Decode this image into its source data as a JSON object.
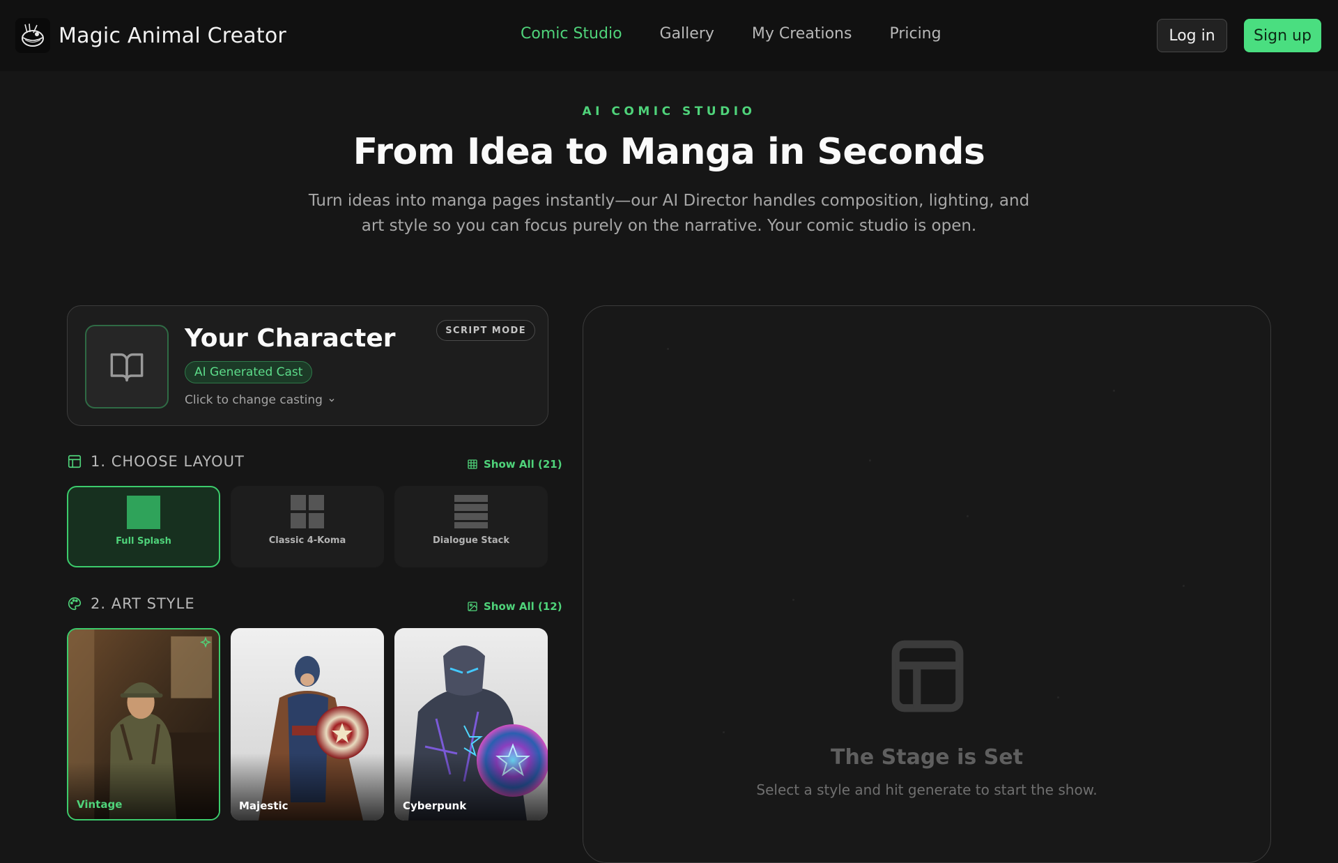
{
  "header": {
    "brand_name": "Magic Animal Creator",
    "logo_icon": "ramen-bowl-logo",
    "nav": [
      {
        "label": "Comic Studio",
        "active": true
      },
      {
        "label": "Gallery",
        "active": false
      },
      {
        "label": "My Creations",
        "active": false
      },
      {
        "label": "Pricing",
        "active": false
      }
    ],
    "login_label": "Log in",
    "signup_label": "Sign up"
  },
  "hero": {
    "eyebrow": "AI COMIC STUDIO",
    "title": "From Idea to Manga in Seconds",
    "subtitle": "Turn ideas into manga pages instantly—our AI Director handles composition, lighting, and art style so you can focus purely on the narrative. Your comic studio is open."
  },
  "character": {
    "title": "Your Character",
    "badge": "AI Generated Cast",
    "change_label": "Click to change casting",
    "mode_pill": "SCRIPT MODE",
    "icon": "open-book-icon"
  },
  "layout_section": {
    "title": "1. CHOOSE LAYOUT",
    "show_all": "Show All (21)",
    "options": [
      {
        "label": "Full Splash",
        "selected": true
      },
      {
        "label": "Classic 4-Koma",
        "selected": false
      },
      {
        "label": "Dialogue Stack",
        "selected": false
      }
    ]
  },
  "style_section": {
    "title": "2. ART STYLE",
    "show_all": "Show All (12)",
    "options": [
      {
        "label": "Vintage",
        "selected": true
      },
      {
        "label": "Majestic",
        "selected": false
      },
      {
        "label": "Cyberpunk",
        "selected": false
      }
    ]
  },
  "stage": {
    "title": "The Stage is Set",
    "subtitle": "Select a style and hit generate to start the show.",
    "icon": "layout-template-icon"
  },
  "colors": {
    "accent": "#4ade80",
    "background": "#161616",
    "header_bg": "#111111"
  }
}
